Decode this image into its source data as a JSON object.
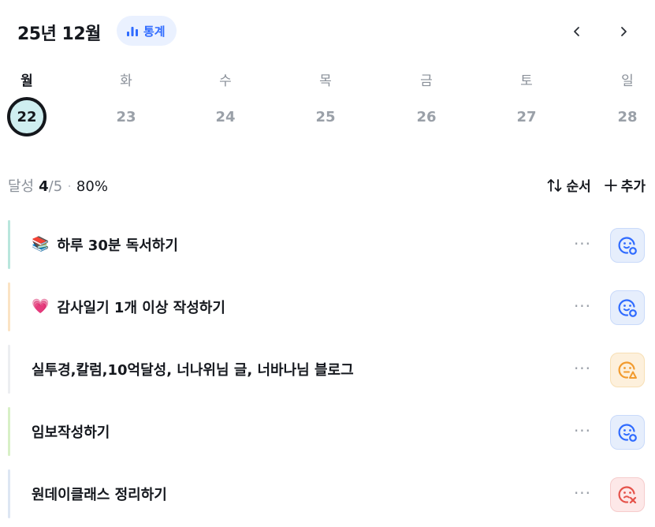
{
  "header": {
    "month_title": "25년 12월",
    "stats_label": "통계",
    "prev_icon": "chevron-left-icon",
    "next_icon": "chevron-right-icon"
  },
  "week": {
    "days": [
      {
        "dow": "월",
        "date": "22",
        "selected": true
      },
      {
        "dow": "화",
        "date": "23",
        "selected": false
      },
      {
        "dow": "수",
        "date": "24",
        "selected": false
      },
      {
        "dow": "목",
        "date": "25",
        "selected": false
      },
      {
        "dow": "금",
        "date": "26",
        "selected": false
      },
      {
        "dow": "토",
        "date": "27",
        "selected": false
      },
      {
        "dow": "일",
        "date": "28",
        "selected": false
      }
    ]
  },
  "summary": {
    "label": "달성",
    "count": "4",
    "total": "/5",
    "separator": "·",
    "percent": "80%",
    "order_label": "순서",
    "add_label": "추가"
  },
  "tasks": [
    {
      "emoji": "📚",
      "title": "하루 30분 독서하기",
      "bar_color": "#b9e6dd",
      "status": "done",
      "status_color": "#2f6bff"
    },
    {
      "emoji": "💗",
      "title": "감사일기 1개 이상 작성하기",
      "bar_color": "#fbe3c4",
      "status": "done",
      "status_color": "#2f6bff"
    },
    {
      "emoji": "",
      "title": "실투경,칼럼,10억달성, 너나위님 글, 너바나님 블로그",
      "bar_color": "#eceef1",
      "status": "partial",
      "status_color": "#f29b2e"
    },
    {
      "emoji": "",
      "title": "임보작성하기",
      "bar_color": "#d8f0c6",
      "status": "done",
      "status_color": "#2f6bff"
    },
    {
      "emoji": "",
      "title": "원데이클래스 정리하기",
      "bar_color": "#dde6f3",
      "status": "failed",
      "status_color": "#e5534b"
    }
  ],
  "more_label": "···"
}
